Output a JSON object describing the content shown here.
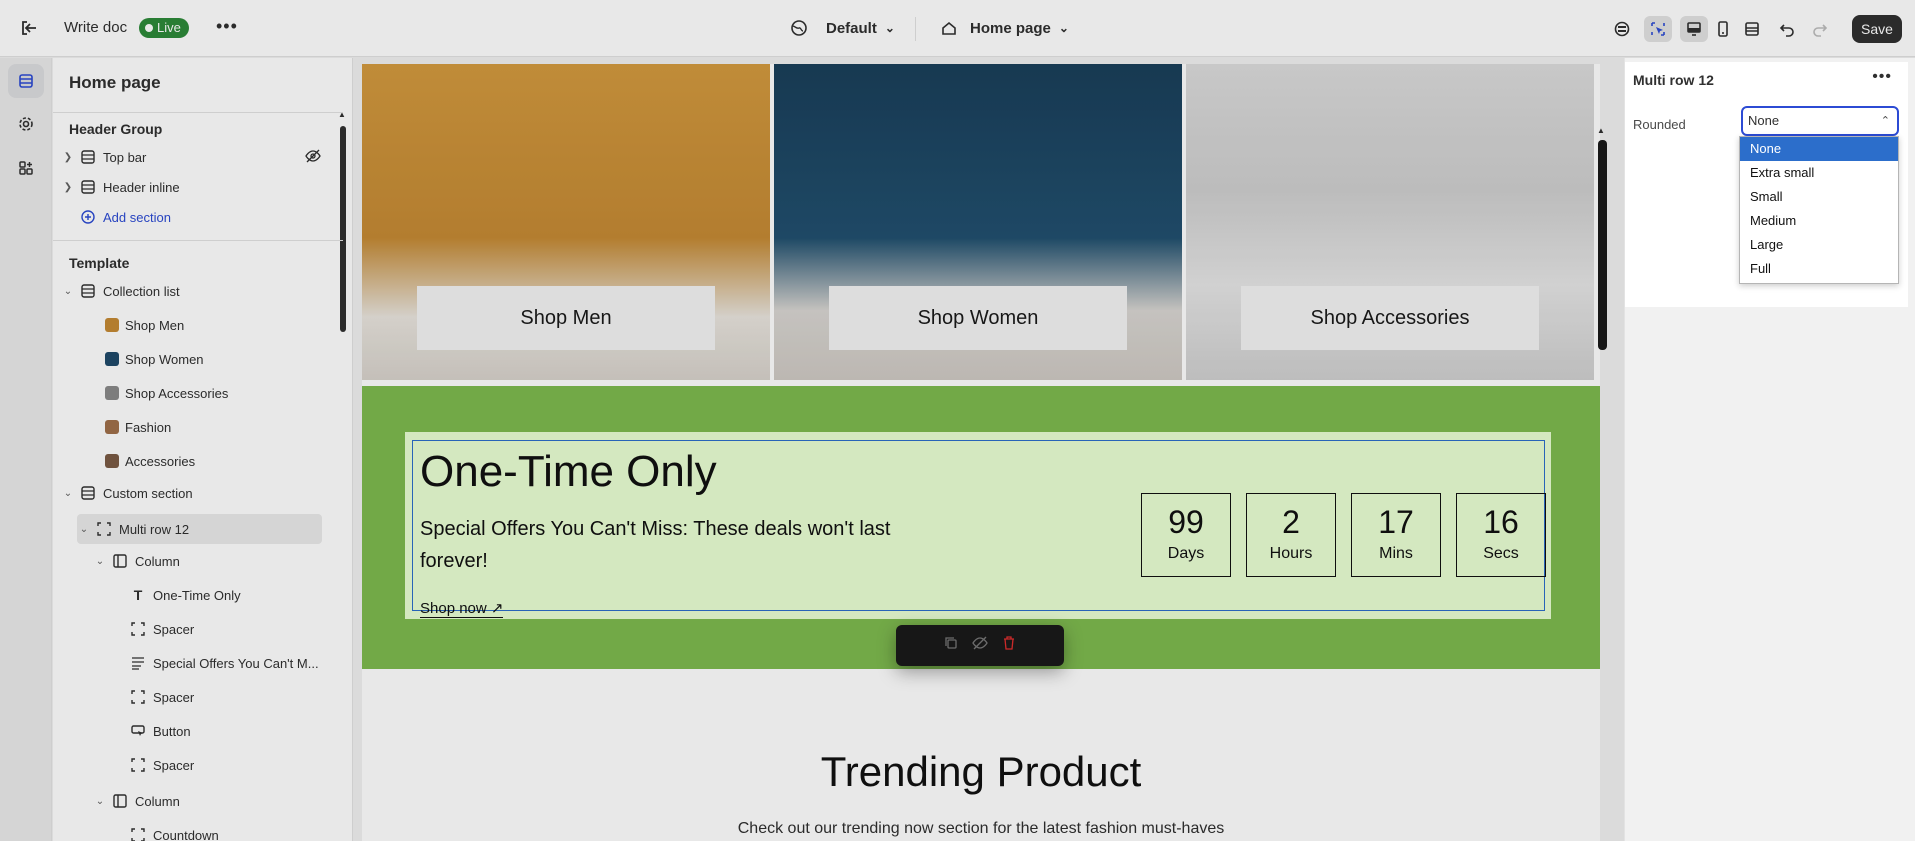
{
  "topbar": {
    "doc_title": "Write doc",
    "status_badge": "Live",
    "theme_dropdown": "Default",
    "page_dropdown": "Home page",
    "save_label": "Save"
  },
  "sidebar": {
    "title": "Home page",
    "header_group": {
      "label": "Header Group",
      "items": [
        "Top bar",
        "Header inline"
      ],
      "add_section": "Add section"
    },
    "template": {
      "label": "Template",
      "collection_list": {
        "label": "Collection list",
        "items": [
          "Shop Men",
          "Shop Women",
          "Shop Accessories",
          "Fashion",
          "Accessories"
        ]
      },
      "custom_section": {
        "label": "Custom section",
        "multi_row": "Multi row 12",
        "column1": {
          "label": "Column",
          "items": [
            "One-Time Only",
            "Spacer",
            "Special Offers You Can't M...",
            "Spacer",
            "Button",
            "Spacer"
          ]
        },
        "column2": {
          "label": "Column",
          "items": [
            "Countdown"
          ]
        }
      }
    }
  },
  "preview": {
    "collections": [
      "Shop Men",
      "Shop Women",
      "Shop Accessories"
    ],
    "promo": {
      "title": "One-Time Only",
      "subtitle": "Special Offers You Can't Miss: These deals won't last forever!",
      "link": "Shop now",
      "countdown": [
        {
          "value": "99",
          "unit": "Days"
        },
        {
          "value": "2",
          "unit": "Hours"
        },
        {
          "value": "17",
          "unit": "Mins"
        },
        {
          "value": "16",
          "unit": "Secs"
        }
      ]
    },
    "trending": {
      "title": "Trending Product",
      "subtitle": "Check out our trending now section for the latest fashion must-haves"
    }
  },
  "settings": {
    "panel_title": "Multi row 12",
    "field_label": "Rounded",
    "field_value": "None",
    "options": [
      "None",
      "Extra small",
      "Small",
      "Medium",
      "Large",
      "Full"
    ],
    "selected_option": "None"
  },
  "colors": {
    "live_green": "#2e8a3a",
    "promo_bg": "#7eba4f",
    "promo_inner": "#eaffd4",
    "select_highlight": "#2c6ecb",
    "add_section_blue": "#2c4bd4"
  }
}
